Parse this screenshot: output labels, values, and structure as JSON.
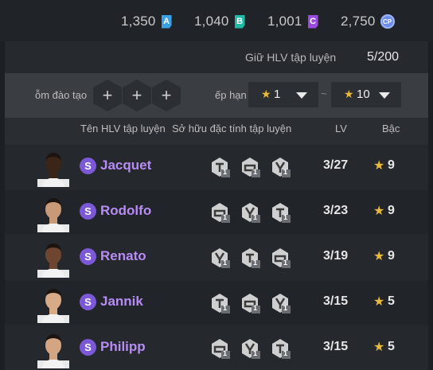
{
  "currencies": [
    {
      "value": "1,350",
      "badge": "A",
      "color": "#3aa0e6",
      "icon": "a-ticket-icon"
    },
    {
      "value": "1,040",
      "badge": "B",
      "color": "#1fb9a6",
      "icon": "b-ticket-icon"
    },
    {
      "value": "1,001",
      "badge": "C",
      "color": "#9b4be0",
      "icon": "c-ticket-icon"
    },
    {
      "value": "2,750",
      "badge": "CP",
      "color": "#6d8ee8",
      "icon": "cp-coin-icon"
    }
  ],
  "hold": {
    "label": "Giữ HLV tập luyện",
    "value": "5/200"
  },
  "filters": {
    "training_label": "ỗm đào tạo",
    "rank_label": "ếp hạn",
    "rank_from": "1",
    "rank_sep": "~",
    "rank_to": "10",
    "add_symbol": "+"
  },
  "headers": {
    "name": "Tên HLV tập luyện",
    "traits": "Sở hữu đặc tính tập luyện",
    "level": "LV",
    "tier": "Bậc"
  },
  "coaches": [
    {
      "badge": "S",
      "name": "Jacquet",
      "level": "3/27",
      "tier": "9",
      "traits": [
        "1",
        "1",
        "1"
      ],
      "skin": "#3a2518"
    },
    {
      "badge": "S",
      "name": "Rodolfo",
      "level": "3/23",
      "tier": "9",
      "traits": [
        "1",
        "1",
        "1"
      ],
      "skin": "#c99a78"
    },
    {
      "badge": "S",
      "name": "Renato",
      "level": "3/19",
      "tier": "9",
      "traits": [
        "1",
        "1",
        "1"
      ],
      "skin": "#6e4630"
    },
    {
      "badge": "S",
      "name": "Jannik",
      "level": "3/15",
      "tier": "5",
      "traits": [
        "1",
        "1",
        "1"
      ],
      "skin": "#d8ab88"
    },
    {
      "badge": "S",
      "name": "Philipp",
      "level": "3/15",
      "tier": "5",
      "traits": [
        "1",
        "1",
        "1"
      ],
      "skin": "#d3a583"
    }
  ],
  "colors": {
    "accent_purple": "#b78cf6",
    "star_gold": "#e8b93a"
  }
}
